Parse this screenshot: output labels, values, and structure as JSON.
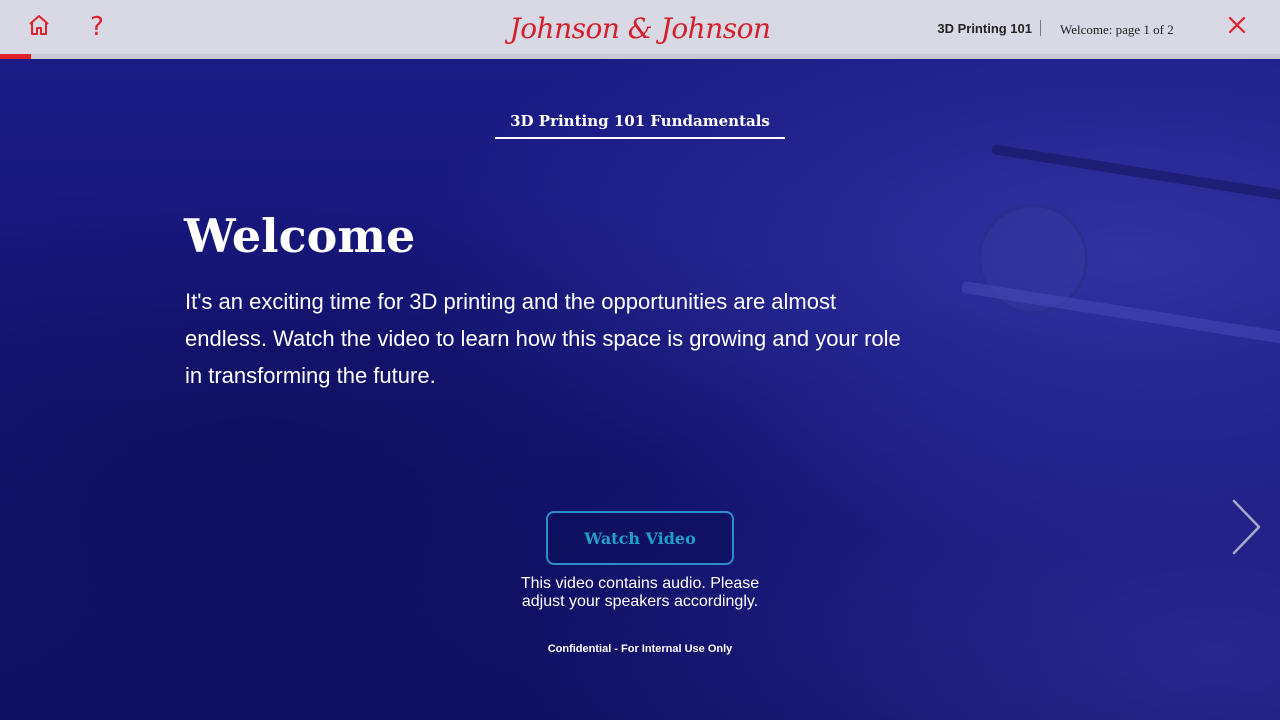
{
  "header": {
    "logo_text": "Johnson & Johnson",
    "course_name": "3D Printing 101",
    "page_info": "Welcome: page 1 of 2",
    "home_icon": "home-icon",
    "help_icon": "help-icon",
    "help_glyph": "?",
    "close_icon": "close-icon",
    "progress": 0.024
  },
  "main": {
    "course_title": "3D Printing 101 Fundamentals",
    "heading": "Welcome",
    "intro": "It's an exciting time for 3D printing and the opportunities are almost endless. Watch the video to learn how this space is growing and your role in transforming the future.",
    "watch_button": "Watch Video",
    "audio_note": "This video contains audio. Please adjust your speakers accordingly.",
    "confidential": "Confidential - For Internal Use Only",
    "next_icon": "chevron-right-icon"
  },
  "colors": {
    "brand_red": "#e0222b",
    "background_blue": "#1a1a7a",
    "button_teal": "#1ea0c8",
    "topbar_gray": "#d9d9e5"
  }
}
